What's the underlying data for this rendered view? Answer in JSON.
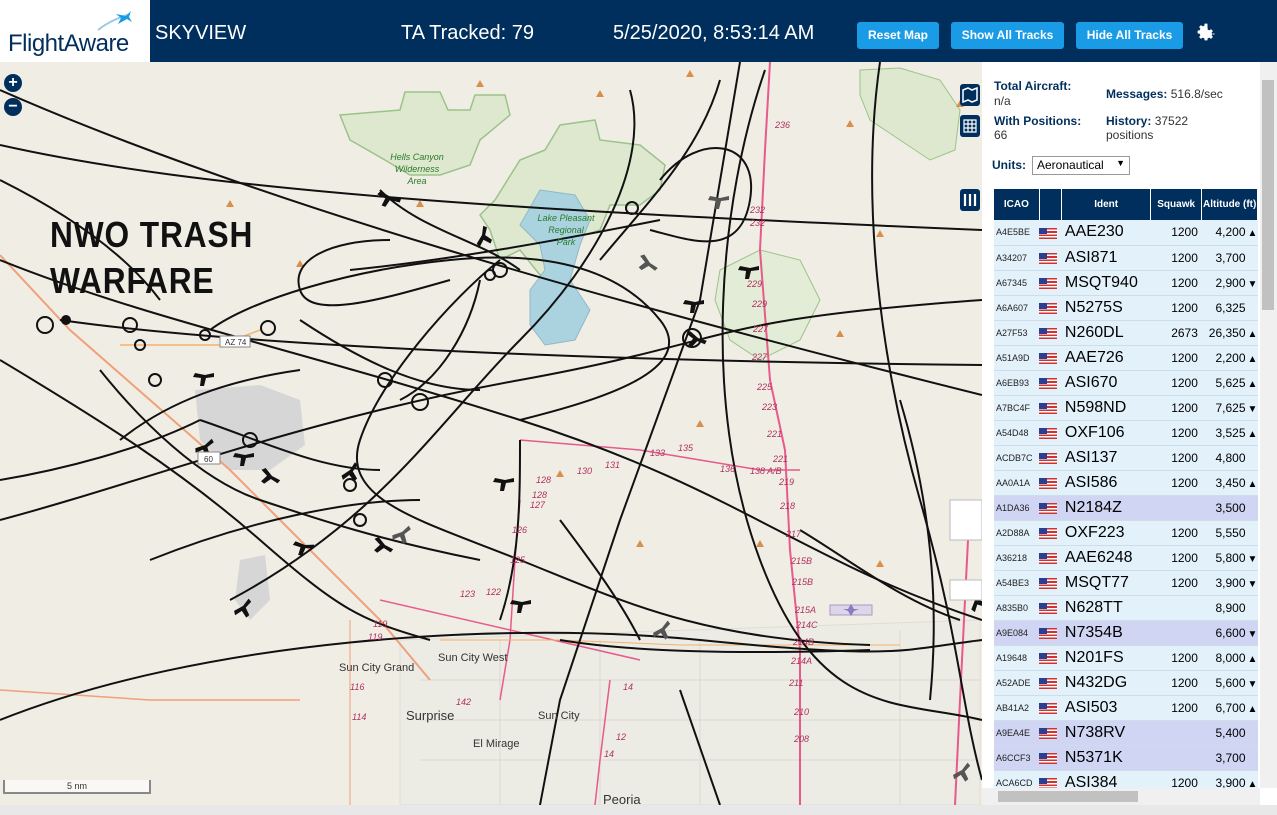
{
  "header": {
    "logo_text": "FlightAware",
    "app_title": "SKYVIEW",
    "tracked_text": "TA Tracked: 79",
    "datetime": "5/25/2020, 8:53:14 AM",
    "buttons": {
      "reset": "Reset Map",
      "show": "Show All Tracks",
      "hide": "Hide All Tracks"
    },
    "colors": {
      "bar": "#002f5d",
      "button": "#1a9be5"
    }
  },
  "map": {
    "overlay_text_line1": "NWO TRASH",
    "overlay_text_line2": "WARFARE",
    "scale_label": "5 nm",
    "place_labels": {
      "hells_canyon": [
        "Hells Canyon",
        "Wilderness",
        "Area"
      ],
      "lake_pleasant": [
        "Lake Pleasant",
        "Regional",
        "Park"
      ],
      "sun_city_grand": "Sun City Grand",
      "sun_city_west": "Sun City West",
      "surprise": "Surprise",
      "sun_city": "Sun City",
      "el_mirage": "El Mirage",
      "peoria": "Peoria",
      "az74": "AZ 74",
      "us60": "60"
    },
    "road_numbers": [
      "236",
      "232",
      "232",
      "229",
      "229",
      "227",
      "227",
      "225",
      "223",
      "221",
      "221",
      "219",
      "218",
      "217",
      "215B",
      "215B",
      "215A",
      "214C",
      "214B",
      "214A",
      "211",
      "210",
      "208",
      "128",
      "128",
      "127",
      "126",
      "125",
      "123",
      "122",
      "119",
      "119",
      "116",
      "114",
      "142",
      "131",
      "133",
      "135",
      "136",
      "138 A/B",
      "130",
      "14",
      "12",
      "14"
    ]
  },
  "sidebar": {
    "total_aircraft_label": "Total Aircraft:",
    "total_aircraft_value": "n/a",
    "messages_label": "Messages:",
    "messages_value": "516.8/sec",
    "positions_label": "With Positions:",
    "positions_value": "66",
    "history_label": "History:",
    "history_value": "37522",
    "history_unit": "positions",
    "units_label": "Units:",
    "units_value": "Aeronautical",
    "columns": [
      "ICAO",
      "Ident",
      "Squawk",
      "Altitude (ft)"
    ],
    "rows": [
      {
        "icao": "A4E5BE",
        "ident": "AAE230",
        "squawk": "1200",
        "alt": "4,200",
        "trend": "▲",
        "sel": false
      },
      {
        "icao": "A34207",
        "ident": "ASI871",
        "squawk": "1200",
        "alt": "3,700",
        "trend": "",
        "sel": false
      },
      {
        "icao": "A67345",
        "ident": "MSQT940",
        "squawk": "1200",
        "alt": "2,900",
        "trend": "▼",
        "sel": false
      },
      {
        "icao": "A6A607",
        "ident": "N5275S",
        "squawk": "1200",
        "alt": "6,325",
        "trend": "",
        "sel": false
      },
      {
        "icao": "A27F53",
        "ident": "N260DL",
        "squawk": "2673",
        "alt": "26,350",
        "trend": "▲",
        "sel": false
      },
      {
        "icao": "A51A9D",
        "ident": "AAE726",
        "squawk": "1200",
        "alt": "2,200",
        "trend": "▲",
        "sel": false
      },
      {
        "icao": "A6EB93",
        "ident": "ASI670",
        "squawk": "1200",
        "alt": "5,625",
        "trend": "▲",
        "sel": false
      },
      {
        "icao": "A7BC4F",
        "ident": "N598ND",
        "squawk": "1200",
        "alt": "7,625",
        "trend": "▼",
        "sel": false
      },
      {
        "icao": "A54D48",
        "ident": "OXF106",
        "squawk": "1200",
        "alt": "3,525",
        "trend": "▲",
        "sel": false
      },
      {
        "icao": "ACDB7C",
        "ident": "ASI137",
        "squawk": "1200",
        "alt": "4,800",
        "trend": "",
        "sel": false
      },
      {
        "icao": "AA0A1A",
        "ident": "ASI586",
        "squawk": "1200",
        "alt": "3,450",
        "trend": "▲",
        "sel": false
      },
      {
        "icao": "A1DA36",
        "ident": "N2184Z",
        "squawk": "",
        "alt": "3,500",
        "trend": "",
        "sel": true
      },
      {
        "icao": "A2D88A",
        "ident": "OXF223",
        "squawk": "1200",
        "alt": "5,550",
        "trend": "",
        "sel": false
      },
      {
        "icao": "A36218",
        "ident": "AAE6248",
        "squawk": "1200",
        "alt": "5,800",
        "trend": "▼",
        "sel": false
      },
      {
        "icao": "A54BE3",
        "ident": "MSQT77",
        "squawk": "1200",
        "alt": "3,900",
        "trend": "▼",
        "sel": false
      },
      {
        "icao": "A835B0",
        "ident": "N628TT",
        "squawk": "",
        "alt": "8,900",
        "trend": "",
        "sel": false
      },
      {
        "icao": "A9E084",
        "ident": "N7354B",
        "squawk": "",
        "alt": "6,600",
        "trend": "▼",
        "sel": true
      },
      {
        "icao": "A19648",
        "ident": "N201FS",
        "squawk": "1200",
        "alt": "8,000",
        "trend": "▲",
        "sel": false
      },
      {
        "icao": "A52ADE",
        "ident": "N432DG",
        "squawk": "1200",
        "alt": "5,600",
        "trend": "▼",
        "sel": false
      },
      {
        "icao": "AB41A2",
        "ident": "ASI503",
        "squawk": "1200",
        "alt": "6,700",
        "trend": "▲",
        "sel": false
      },
      {
        "icao": "A9EA4E",
        "ident": "N738RV",
        "squawk": "",
        "alt": "5,400",
        "trend": "",
        "sel": true
      },
      {
        "icao": "A6CCF3",
        "ident": "N5371K",
        "squawk": "",
        "alt": "3,700",
        "trend": "",
        "sel": true
      },
      {
        "icao": "ACA6CD",
        "ident": "ASI384",
        "squawk": "1200",
        "alt": "3,900",
        "trend": "▲",
        "sel": false
      }
    ]
  },
  "icons": [
    "plane-logo-icon",
    "gear-icon",
    "zoom-in-icon",
    "zoom-out-icon",
    "map-layer-icon",
    "grid-icon",
    "columns-icon",
    "info-icon",
    "us-flag-icon"
  ]
}
